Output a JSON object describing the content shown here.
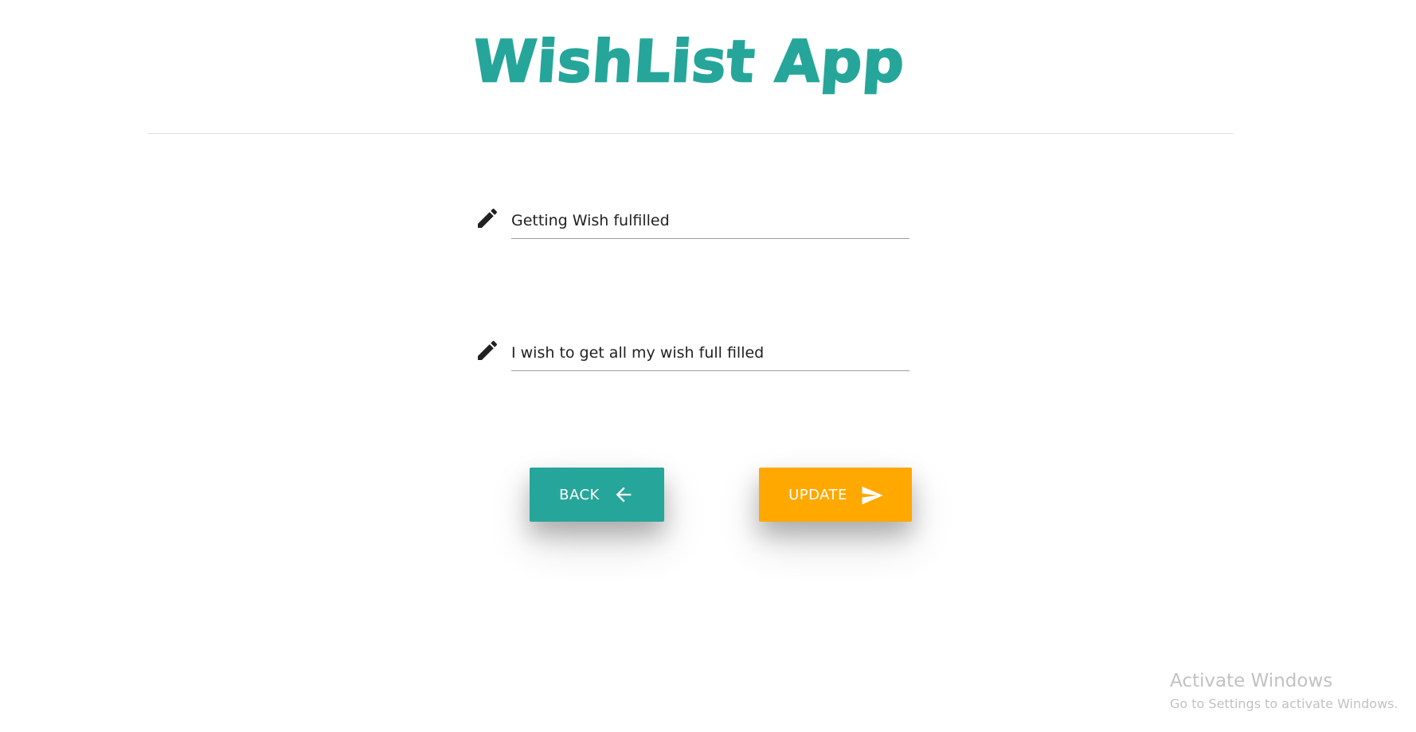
{
  "header": {
    "title": "WishList App"
  },
  "form": {
    "title_field": {
      "value": "Getting Wish fulfilled",
      "icon": "pencil-icon"
    },
    "description_field": {
      "value": "I wish to get all my wish full filled",
      "icon": "pencil-icon"
    }
  },
  "actions": {
    "back_label": "BACK",
    "back_icon": "arrow-left-icon",
    "back_color": "#26a69a",
    "update_label": "UPDATE",
    "update_icon": "send-icon",
    "update_color": "#ffa800"
  },
  "watermark": {
    "title": "Activate Windows",
    "subtitle": "Go to Settings to activate Windows."
  },
  "theme": {
    "accent": "#26a69a",
    "divider": "#e0e0e0"
  }
}
